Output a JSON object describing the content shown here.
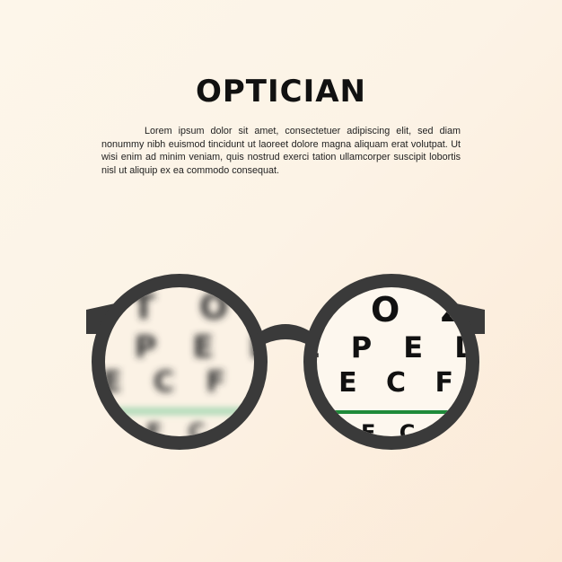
{
  "title": "OPTICIAN",
  "body_text": "Lorem ipsum dolor sit amet, consectetuer adipiscing elit, sed diam nonummy nibh euismod tincidunt ut laoreet dolore magna aliquam erat volutpat. Ut wisi enim ad minim veniam, quis nostrud exerci tation ullamcorper suscipit lobortis nisl ut aliquip ex ea commodo consequat.",
  "eye_chart": {
    "row1": "T O Z",
    "row2": "L P E D",
    "row3": "P E C F D",
    "row4": "E D F C Z P"
  },
  "colors": {
    "frame": "#3a3a3a",
    "chart_line_left": "#8fd0a5",
    "chart_line_right": "#1f8a3a"
  }
}
